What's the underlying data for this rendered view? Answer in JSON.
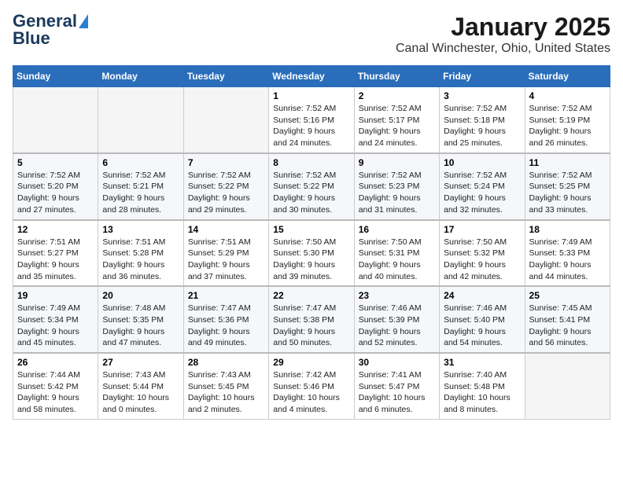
{
  "logo": {
    "line1": "General",
    "line2": "Blue"
  },
  "title": "January 2025",
  "location": "Canal Winchester, Ohio, United States",
  "days_of_week": [
    "Sunday",
    "Monday",
    "Tuesday",
    "Wednesday",
    "Thursday",
    "Friday",
    "Saturday"
  ],
  "weeks": [
    [
      {
        "day": "",
        "empty": true
      },
      {
        "day": "",
        "empty": true
      },
      {
        "day": "",
        "empty": true
      },
      {
        "day": "1",
        "info": "Sunrise: 7:52 AM\nSunset: 5:16 PM\nDaylight: 9 hours\nand 24 minutes."
      },
      {
        "day": "2",
        "info": "Sunrise: 7:52 AM\nSunset: 5:17 PM\nDaylight: 9 hours\nand 24 minutes."
      },
      {
        "day": "3",
        "info": "Sunrise: 7:52 AM\nSunset: 5:18 PM\nDaylight: 9 hours\nand 25 minutes."
      },
      {
        "day": "4",
        "info": "Sunrise: 7:52 AM\nSunset: 5:19 PM\nDaylight: 9 hours\nand 26 minutes."
      }
    ],
    [
      {
        "day": "5",
        "info": "Sunrise: 7:52 AM\nSunset: 5:20 PM\nDaylight: 9 hours\nand 27 minutes."
      },
      {
        "day": "6",
        "info": "Sunrise: 7:52 AM\nSunset: 5:21 PM\nDaylight: 9 hours\nand 28 minutes."
      },
      {
        "day": "7",
        "info": "Sunrise: 7:52 AM\nSunset: 5:22 PM\nDaylight: 9 hours\nand 29 minutes."
      },
      {
        "day": "8",
        "info": "Sunrise: 7:52 AM\nSunset: 5:22 PM\nDaylight: 9 hours\nand 30 minutes."
      },
      {
        "day": "9",
        "info": "Sunrise: 7:52 AM\nSunset: 5:23 PM\nDaylight: 9 hours\nand 31 minutes."
      },
      {
        "day": "10",
        "info": "Sunrise: 7:52 AM\nSunset: 5:24 PM\nDaylight: 9 hours\nand 32 minutes."
      },
      {
        "day": "11",
        "info": "Sunrise: 7:52 AM\nSunset: 5:25 PM\nDaylight: 9 hours\nand 33 minutes."
      }
    ],
    [
      {
        "day": "12",
        "info": "Sunrise: 7:51 AM\nSunset: 5:27 PM\nDaylight: 9 hours\nand 35 minutes."
      },
      {
        "day": "13",
        "info": "Sunrise: 7:51 AM\nSunset: 5:28 PM\nDaylight: 9 hours\nand 36 minutes."
      },
      {
        "day": "14",
        "info": "Sunrise: 7:51 AM\nSunset: 5:29 PM\nDaylight: 9 hours\nand 37 minutes."
      },
      {
        "day": "15",
        "info": "Sunrise: 7:50 AM\nSunset: 5:30 PM\nDaylight: 9 hours\nand 39 minutes."
      },
      {
        "day": "16",
        "info": "Sunrise: 7:50 AM\nSunset: 5:31 PM\nDaylight: 9 hours\nand 40 minutes."
      },
      {
        "day": "17",
        "info": "Sunrise: 7:50 AM\nSunset: 5:32 PM\nDaylight: 9 hours\nand 42 minutes."
      },
      {
        "day": "18",
        "info": "Sunrise: 7:49 AM\nSunset: 5:33 PM\nDaylight: 9 hours\nand 44 minutes."
      }
    ],
    [
      {
        "day": "19",
        "info": "Sunrise: 7:49 AM\nSunset: 5:34 PM\nDaylight: 9 hours\nand 45 minutes."
      },
      {
        "day": "20",
        "info": "Sunrise: 7:48 AM\nSunset: 5:35 PM\nDaylight: 9 hours\nand 47 minutes."
      },
      {
        "day": "21",
        "info": "Sunrise: 7:47 AM\nSunset: 5:36 PM\nDaylight: 9 hours\nand 49 minutes."
      },
      {
        "day": "22",
        "info": "Sunrise: 7:47 AM\nSunset: 5:38 PM\nDaylight: 9 hours\nand 50 minutes."
      },
      {
        "day": "23",
        "info": "Sunrise: 7:46 AM\nSunset: 5:39 PM\nDaylight: 9 hours\nand 52 minutes."
      },
      {
        "day": "24",
        "info": "Sunrise: 7:46 AM\nSunset: 5:40 PM\nDaylight: 9 hours\nand 54 minutes."
      },
      {
        "day": "25",
        "info": "Sunrise: 7:45 AM\nSunset: 5:41 PM\nDaylight: 9 hours\nand 56 minutes."
      }
    ],
    [
      {
        "day": "26",
        "info": "Sunrise: 7:44 AM\nSunset: 5:42 PM\nDaylight: 9 hours\nand 58 minutes."
      },
      {
        "day": "27",
        "info": "Sunrise: 7:43 AM\nSunset: 5:44 PM\nDaylight: 10 hours\nand 0 minutes."
      },
      {
        "day": "28",
        "info": "Sunrise: 7:43 AM\nSunset: 5:45 PM\nDaylight: 10 hours\nand 2 minutes."
      },
      {
        "day": "29",
        "info": "Sunrise: 7:42 AM\nSunset: 5:46 PM\nDaylight: 10 hours\nand 4 minutes."
      },
      {
        "day": "30",
        "info": "Sunrise: 7:41 AM\nSunset: 5:47 PM\nDaylight: 10 hours\nand 6 minutes."
      },
      {
        "day": "31",
        "info": "Sunrise: 7:40 AM\nSunset: 5:48 PM\nDaylight: 10 hours\nand 8 minutes."
      },
      {
        "day": "",
        "empty": true
      }
    ]
  ]
}
